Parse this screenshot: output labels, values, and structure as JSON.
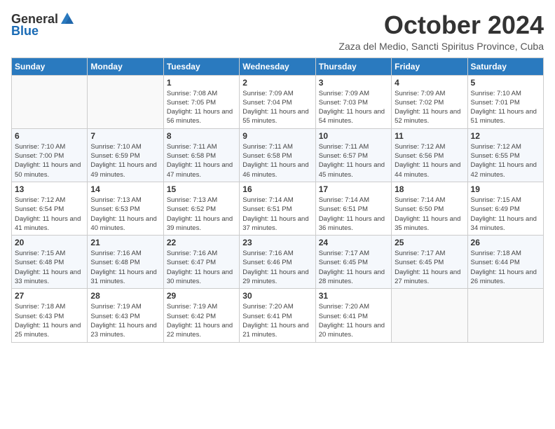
{
  "header": {
    "logo_general": "General",
    "logo_blue": "Blue",
    "month_title": "October 2024",
    "subtitle": "Zaza del Medio, Sancti Spiritus Province, Cuba"
  },
  "days_of_week": [
    "Sunday",
    "Monday",
    "Tuesday",
    "Wednesday",
    "Thursday",
    "Friday",
    "Saturday"
  ],
  "weeks": [
    [
      {
        "day": "",
        "sunrise": "",
        "sunset": "",
        "daylight": ""
      },
      {
        "day": "",
        "sunrise": "",
        "sunset": "",
        "daylight": ""
      },
      {
        "day": "1",
        "sunrise": "Sunrise: 7:08 AM",
        "sunset": "Sunset: 7:05 PM",
        "daylight": "Daylight: 11 hours and 56 minutes."
      },
      {
        "day": "2",
        "sunrise": "Sunrise: 7:09 AM",
        "sunset": "Sunset: 7:04 PM",
        "daylight": "Daylight: 11 hours and 55 minutes."
      },
      {
        "day": "3",
        "sunrise": "Sunrise: 7:09 AM",
        "sunset": "Sunset: 7:03 PM",
        "daylight": "Daylight: 11 hours and 54 minutes."
      },
      {
        "day": "4",
        "sunrise": "Sunrise: 7:09 AM",
        "sunset": "Sunset: 7:02 PM",
        "daylight": "Daylight: 11 hours and 52 minutes."
      },
      {
        "day": "5",
        "sunrise": "Sunrise: 7:10 AM",
        "sunset": "Sunset: 7:01 PM",
        "daylight": "Daylight: 11 hours and 51 minutes."
      }
    ],
    [
      {
        "day": "6",
        "sunrise": "Sunrise: 7:10 AM",
        "sunset": "Sunset: 7:00 PM",
        "daylight": "Daylight: 11 hours and 50 minutes."
      },
      {
        "day": "7",
        "sunrise": "Sunrise: 7:10 AM",
        "sunset": "Sunset: 6:59 PM",
        "daylight": "Daylight: 11 hours and 49 minutes."
      },
      {
        "day": "8",
        "sunrise": "Sunrise: 7:11 AM",
        "sunset": "Sunset: 6:58 PM",
        "daylight": "Daylight: 11 hours and 47 minutes."
      },
      {
        "day": "9",
        "sunrise": "Sunrise: 7:11 AM",
        "sunset": "Sunset: 6:58 PM",
        "daylight": "Daylight: 11 hours and 46 minutes."
      },
      {
        "day": "10",
        "sunrise": "Sunrise: 7:11 AM",
        "sunset": "Sunset: 6:57 PM",
        "daylight": "Daylight: 11 hours and 45 minutes."
      },
      {
        "day": "11",
        "sunrise": "Sunrise: 7:12 AM",
        "sunset": "Sunset: 6:56 PM",
        "daylight": "Daylight: 11 hours and 44 minutes."
      },
      {
        "day": "12",
        "sunrise": "Sunrise: 7:12 AM",
        "sunset": "Sunset: 6:55 PM",
        "daylight": "Daylight: 11 hours and 42 minutes."
      }
    ],
    [
      {
        "day": "13",
        "sunrise": "Sunrise: 7:12 AM",
        "sunset": "Sunset: 6:54 PM",
        "daylight": "Daylight: 11 hours and 41 minutes."
      },
      {
        "day": "14",
        "sunrise": "Sunrise: 7:13 AM",
        "sunset": "Sunset: 6:53 PM",
        "daylight": "Daylight: 11 hours and 40 minutes."
      },
      {
        "day": "15",
        "sunrise": "Sunrise: 7:13 AM",
        "sunset": "Sunset: 6:52 PM",
        "daylight": "Daylight: 11 hours and 39 minutes."
      },
      {
        "day": "16",
        "sunrise": "Sunrise: 7:14 AM",
        "sunset": "Sunset: 6:51 PM",
        "daylight": "Daylight: 11 hours and 37 minutes."
      },
      {
        "day": "17",
        "sunrise": "Sunrise: 7:14 AM",
        "sunset": "Sunset: 6:51 PM",
        "daylight": "Daylight: 11 hours and 36 minutes."
      },
      {
        "day": "18",
        "sunrise": "Sunrise: 7:14 AM",
        "sunset": "Sunset: 6:50 PM",
        "daylight": "Daylight: 11 hours and 35 minutes."
      },
      {
        "day": "19",
        "sunrise": "Sunrise: 7:15 AM",
        "sunset": "Sunset: 6:49 PM",
        "daylight": "Daylight: 11 hours and 34 minutes."
      }
    ],
    [
      {
        "day": "20",
        "sunrise": "Sunrise: 7:15 AM",
        "sunset": "Sunset: 6:48 PM",
        "daylight": "Daylight: 11 hours and 33 minutes."
      },
      {
        "day": "21",
        "sunrise": "Sunrise: 7:16 AM",
        "sunset": "Sunset: 6:48 PM",
        "daylight": "Daylight: 11 hours and 31 minutes."
      },
      {
        "day": "22",
        "sunrise": "Sunrise: 7:16 AM",
        "sunset": "Sunset: 6:47 PM",
        "daylight": "Daylight: 11 hours and 30 minutes."
      },
      {
        "day": "23",
        "sunrise": "Sunrise: 7:16 AM",
        "sunset": "Sunset: 6:46 PM",
        "daylight": "Daylight: 11 hours and 29 minutes."
      },
      {
        "day": "24",
        "sunrise": "Sunrise: 7:17 AM",
        "sunset": "Sunset: 6:45 PM",
        "daylight": "Daylight: 11 hours and 28 minutes."
      },
      {
        "day": "25",
        "sunrise": "Sunrise: 7:17 AM",
        "sunset": "Sunset: 6:45 PM",
        "daylight": "Daylight: 11 hours and 27 minutes."
      },
      {
        "day": "26",
        "sunrise": "Sunrise: 7:18 AM",
        "sunset": "Sunset: 6:44 PM",
        "daylight": "Daylight: 11 hours and 26 minutes."
      }
    ],
    [
      {
        "day": "27",
        "sunrise": "Sunrise: 7:18 AM",
        "sunset": "Sunset: 6:43 PM",
        "daylight": "Daylight: 11 hours and 25 minutes."
      },
      {
        "day": "28",
        "sunrise": "Sunrise: 7:19 AM",
        "sunset": "Sunset: 6:43 PM",
        "daylight": "Daylight: 11 hours and 23 minutes."
      },
      {
        "day": "29",
        "sunrise": "Sunrise: 7:19 AM",
        "sunset": "Sunset: 6:42 PM",
        "daylight": "Daylight: 11 hours and 22 minutes."
      },
      {
        "day": "30",
        "sunrise": "Sunrise: 7:20 AM",
        "sunset": "Sunset: 6:41 PM",
        "daylight": "Daylight: 11 hours and 21 minutes."
      },
      {
        "day": "31",
        "sunrise": "Sunrise: 7:20 AM",
        "sunset": "Sunset: 6:41 PM",
        "daylight": "Daylight: 11 hours and 20 minutes."
      },
      {
        "day": "",
        "sunrise": "",
        "sunset": "",
        "daylight": ""
      },
      {
        "day": "",
        "sunrise": "",
        "sunset": "",
        "daylight": ""
      }
    ]
  ]
}
